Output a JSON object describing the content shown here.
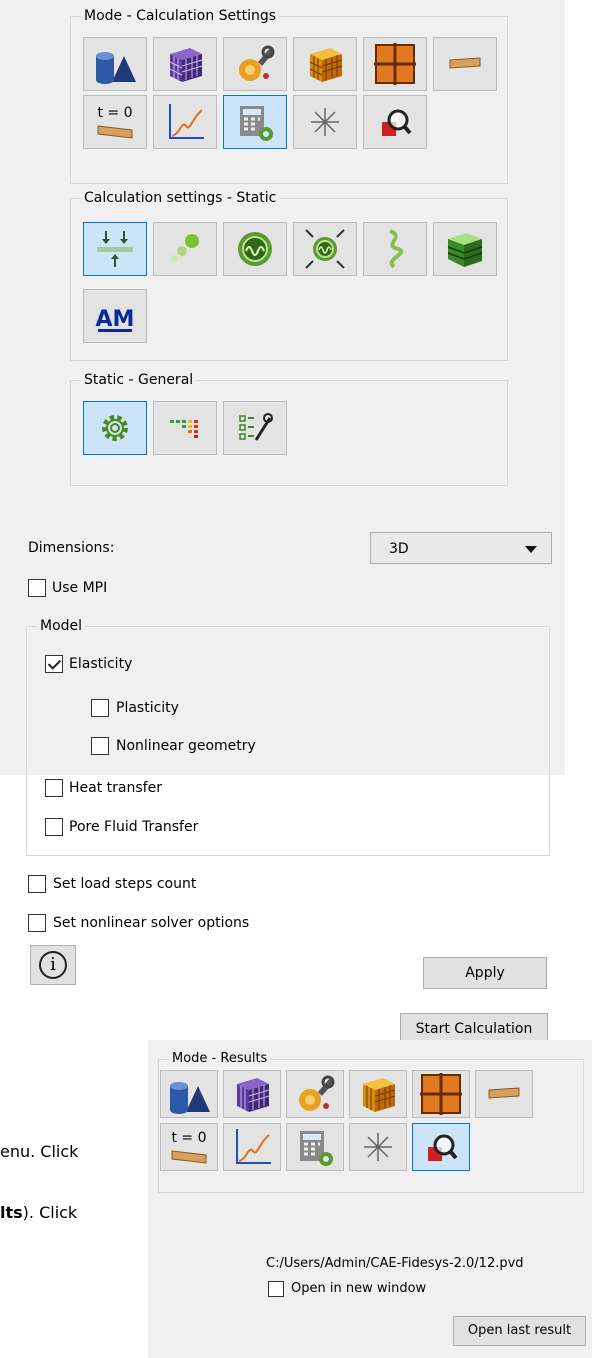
{
  "calc_mode": {
    "title": "Mode - Calculation Settings",
    "tools": [
      {
        "icon": "geometry-icon",
        "selected": false
      },
      {
        "icon": "mesh-icon",
        "selected": false
      },
      {
        "icon": "materials-icon",
        "selected": false
      },
      {
        "icon": "boundary-conditions-icon",
        "selected": false
      },
      {
        "icon": "grid-icon",
        "selected": false
      },
      {
        "icon": "beam-icon",
        "selected": false
      },
      {
        "icon": "initial-conditions-icon",
        "selected": false,
        "label": "t = 0"
      },
      {
        "icon": "curve-icon",
        "selected": false
      },
      {
        "icon": "calculator-settings-icon",
        "selected": true
      },
      {
        "icon": "sparkle-icon",
        "selected": false
      },
      {
        "icon": "results-magnifier-icon",
        "selected": false
      }
    ]
  },
  "calc_static": {
    "title": "Calculation settings - Static",
    "tools": [
      {
        "icon": "static-load-icon",
        "selected": true
      },
      {
        "icon": "dynamic-icon",
        "selected": false
      },
      {
        "icon": "modal-icon",
        "selected": false
      },
      {
        "icon": "buckling-icon",
        "selected": false
      },
      {
        "icon": "helix-icon",
        "selected": false
      },
      {
        "icon": "composite-icon",
        "selected": false
      },
      {
        "icon": "am-logo-icon",
        "selected": false,
        "label": "AM"
      }
    ]
  },
  "static_general": {
    "title": "Static - General",
    "tools": [
      {
        "icon": "gear-icon",
        "selected": true
      },
      {
        "icon": "heatmap-icon",
        "selected": false
      },
      {
        "icon": "solver-tools-icon",
        "selected": false
      }
    ]
  },
  "dimensions": {
    "label": "Dimensions:",
    "value": "3D"
  },
  "use_mpi": {
    "label": "Use MPI",
    "checked": false
  },
  "model": {
    "title": "Model",
    "elasticity": {
      "label": "Elasticity",
      "checked": true
    },
    "plasticity": {
      "label": "Plasticity",
      "checked": false
    },
    "nonlinear_geometry": {
      "label": "Nonlinear geometry",
      "checked": false
    },
    "heat_transfer": {
      "label": "Heat transfer",
      "checked": false
    },
    "pore_fluid": {
      "label": "Pore Fluid Transfer",
      "checked": false
    }
  },
  "load_steps": {
    "label": "Set load steps count",
    "checked": false
  },
  "solver_options": {
    "label": "Set nonlinear solver options",
    "checked": false
  },
  "buttons": {
    "apply": "Apply",
    "start": "Start Calculation",
    "info": "i"
  },
  "results_mode": {
    "title": "Mode - Results",
    "path": "C:/Users/Admin/CAE-Fidesys-2.0/12.pvd",
    "open_new_window": {
      "label": "Open in new window",
      "checked": false
    },
    "open_last": "Open last result"
  },
  "background_text": {
    "line1": "enu. Click",
    "line2_bold": "lts",
    "line2_rest": "). Click"
  },
  "colors": {
    "selected_bg": "#cce4f7",
    "selected_border": "#0078d7",
    "panel_bg": "#f0f0f0"
  }
}
